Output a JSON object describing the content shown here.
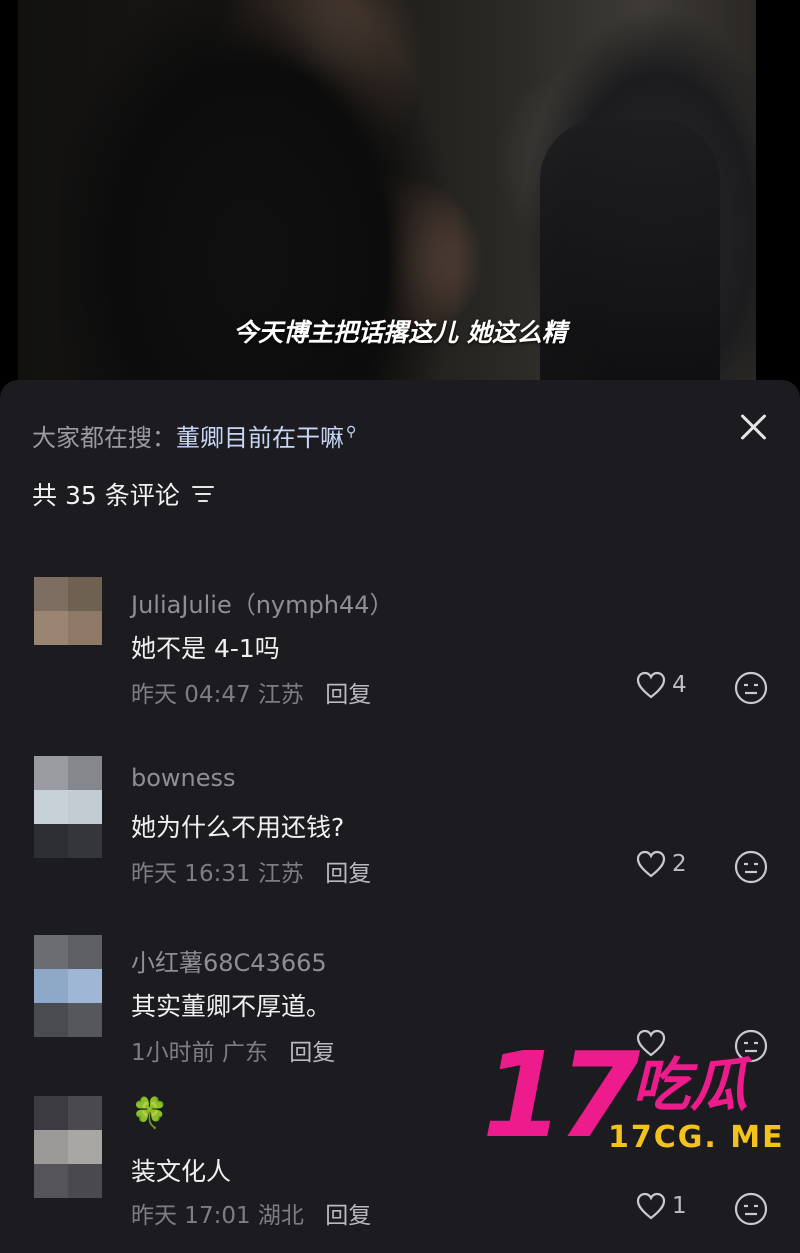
{
  "video": {
    "subtitle": "今天博主把话撂这儿 她这么精"
  },
  "header": {
    "search_prefix": "大家都在搜：",
    "search_term": "董卿目前在干嘛",
    "comment_count": "共 35 条评论"
  },
  "comments": [
    {
      "username": "JuliaJulie（nymph44）",
      "text": "她不是 4-1吗",
      "time": "昨天 04:47",
      "location": "江苏",
      "reply": "回复",
      "likes": "4"
    },
    {
      "username": "bowness",
      "text": "她为什么不用还钱?",
      "time": "昨天 16:31",
      "location": "江苏",
      "reply": "回复",
      "likes": "2"
    },
    {
      "username": "小红薯68C43665",
      "text": "其实董卿不厚道。",
      "time": "1小时前",
      "location": "广东",
      "reply": "回复",
      "likes": ""
    },
    {
      "username": "🍀",
      "text": "装文化人",
      "time": "昨天 17:01",
      "location": "湖北",
      "reply": "回复",
      "likes": "1"
    }
  ],
  "watermark": {
    "number": "17",
    "cn": "吃瓜",
    "url": "17CG. ME"
  },
  "colors": {
    "sheet_bg": "#1b1b20",
    "watermark_pink": "#ee1b8c",
    "watermark_yellow": "#f4c31b"
  }
}
